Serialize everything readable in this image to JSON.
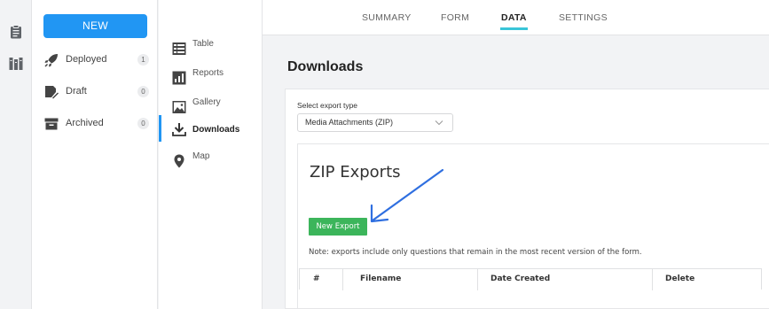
{
  "sidebar": {
    "new_button": "NEW",
    "statuses": [
      {
        "label": "Deployed",
        "count": "1"
      },
      {
        "label": "Draft",
        "count": "0"
      },
      {
        "label": "Archived",
        "count": "0"
      }
    ]
  },
  "tabs": [
    "SUMMARY",
    "FORM",
    "DATA",
    "SETTINGS"
  ],
  "active_tab": "DATA",
  "subnav": [
    "Table",
    "Reports",
    "Gallery",
    "Downloads",
    "Map"
  ],
  "active_subnav": "Downloads",
  "main": {
    "title": "Downloads",
    "select_label": "Select export type",
    "select_value": "Media Attachments (ZIP)",
    "zip_title": "ZIP Exports",
    "new_export_button": "New Export",
    "note": "Note: exports include only questions that remain in the most recent version of the form.",
    "table_headers": [
      "#",
      "Filename",
      "Date Created",
      "Delete"
    ]
  },
  "colors": {
    "primary": "#2196f3",
    "tab_indicator": "#39c5d8",
    "new_export": "#3cb55b",
    "annotation_arrow": "#2f6fe0"
  }
}
